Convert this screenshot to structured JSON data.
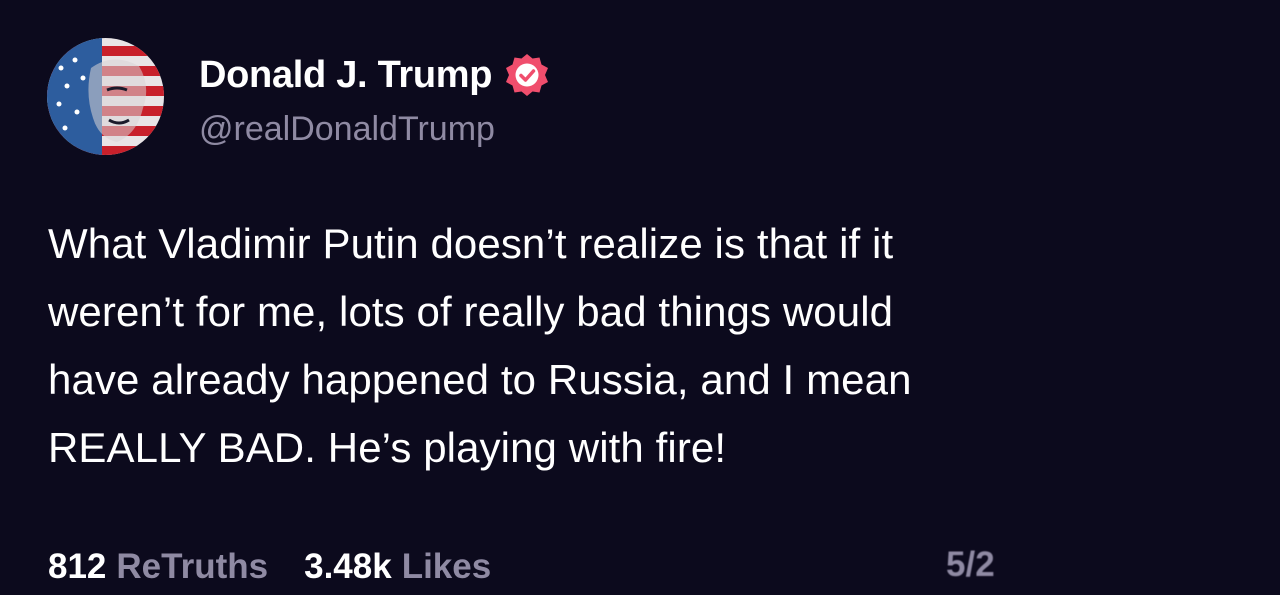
{
  "colors": {
    "background": "#0c0a1d",
    "text": "#ffffff",
    "muted": "#8f8aa3",
    "verified_badge": "#f04e6d"
  },
  "author": {
    "display_name": "Donald J. Trump",
    "handle": "@realDonaldTrump",
    "verified_icon": "verified-badge-icon",
    "avatar_icon": "avatar-image"
  },
  "post": {
    "text": "What Vladimir Putin doesn’t realize is that if it\nweren’t for me, lots of really bad things would\nhave already happened to Russia, and I mean\nREALLY BAD. He’s playing with fire!"
  },
  "stats": {
    "retruths_count": "812",
    "retruths_label": "ReTruths",
    "likes_count": "3.48k",
    "likes_label": "Likes",
    "timestamp": "5/2"
  }
}
